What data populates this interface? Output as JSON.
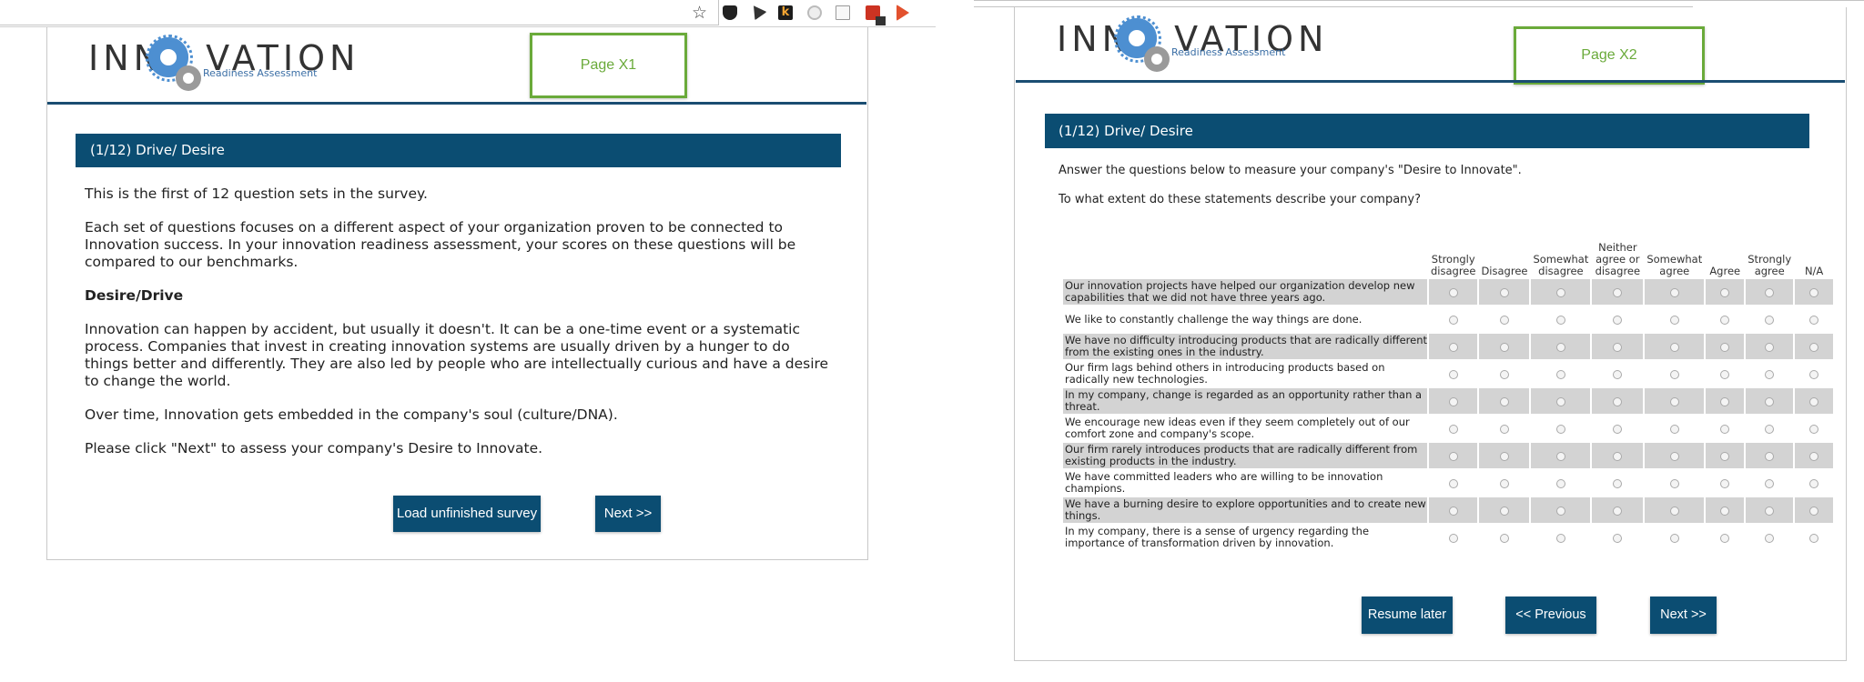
{
  "left_page": {
    "logo": {
      "word": "INNOVATION",
      "sub": "Readiness Assessment"
    },
    "page_tag": "Page X1",
    "section_title": "(1/12) Drive/ Desire",
    "paragraphs": {
      "p1": "This is the first of 12 question sets in the survey.",
      "p2": "Each set of questions focuses on a different aspect of your organization proven to be connected to Innovation success. In your innovation readiness assessment, your scores on these questions will be compared to our benchmarks.",
      "heading": "Desire/Drive",
      "p3": "Innovation can happen by accident, but usually it doesn't. It can be a one-time event or a systematic process. Companies that invest in creating innovation systems are usually driven by a hunger to do things better and differently. They are also led by people who are intellectually curious and have a desire to change the world.",
      "p4": "Over time, Innovation gets embedded in the company's soul (culture/DNA).",
      "p5": "Please click \"Next\" to assess your company's Desire to Innovate."
    },
    "buttons": {
      "load": "Load unfinished survey",
      "next": "Next >>"
    }
  },
  "right_page": {
    "logo": {
      "word": "INNOVATION",
      "sub": "Readiness Assessment"
    },
    "page_tag": "Page X2",
    "section_title": "(1/12) Drive/ Desire",
    "intro1": "Answer the questions below to measure your company's \"Desire to Innovate\".",
    "intro2": "To what extent do these statements describe your company?",
    "columns": [
      "Strongly disagree",
      "Disagree",
      "Somewhat disagree",
      "Neither agree or disagree",
      "Somewhat agree",
      "Agree",
      "Strongly agree",
      "N/A"
    ],
    "statements": [
      "Our innovation projects have helped our organization develop new capabilities that we did not have three years ago.",
      "We like to constantly challenge the way things are done.",
      "We have no difficulty introducing products that are radically different from the existing ones in the industry.",
      "Our firm lags behind others in introducing products based on radically new technologies.",
      "In my company, change is regarded as an opportunity rather than a threat.",
      "We encourage new ideas even if they seem completely out of our comfort zone and company's scope.",
      "Our firm rarely introduces products that are radically different from existing products in the industry.",
      "We have committed leaders who are willing to be innovation champions.",
      "We have a burning desire to explore opportunities and to create new things.",
      "In my company, there is a sense of urgency regarding the importance of transformation driven by innovation."
    ],
    "buttons": {
      "resume": "Resume later",
      "previous": "<< Previous",
      "next": "Next >>"
    }
  },
  "colors": {
    "brand_blue": "#0b4d72",
    "tag_green": "#6aaa3a",
    "logo_blue": "#4d8fd1",
    "row_shade": "#d3d3d3"
  }
}
